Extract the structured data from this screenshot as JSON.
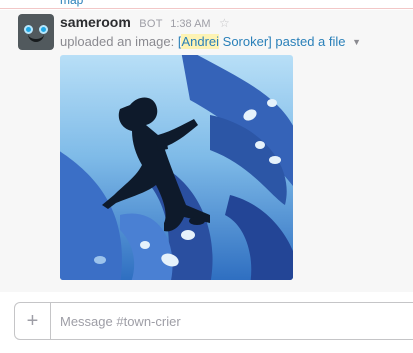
{
  "top_snippet": {
    "prefix": "",
    "link": "map"
  },
  "message": {
    "sender": "sameroom",
    "badge": "BOT",
    "time": "1:38 AM",
    "action_text": "uploaded an image:",
    "file_title": {
      "open_bracket": "[",
      "highlighted_name": "Andrei",
      "rest": " Soroker] pasted a file"
    }
  },
  "icons": {
    "star": "star-icon",
    "caret": "chevron-down-icon",
    "plus": "plus-icon",
    "avatar": "bot-avatar"
  },
  "composer": {
    "plus_label": "+",
    "placeholder": "Message #town-crier"
  },
  "colors": {
    "link": "#2a80b9",
    "highlight": "#fdf3b4",
    "message_bg": "#f7f7f7"
  }
}
